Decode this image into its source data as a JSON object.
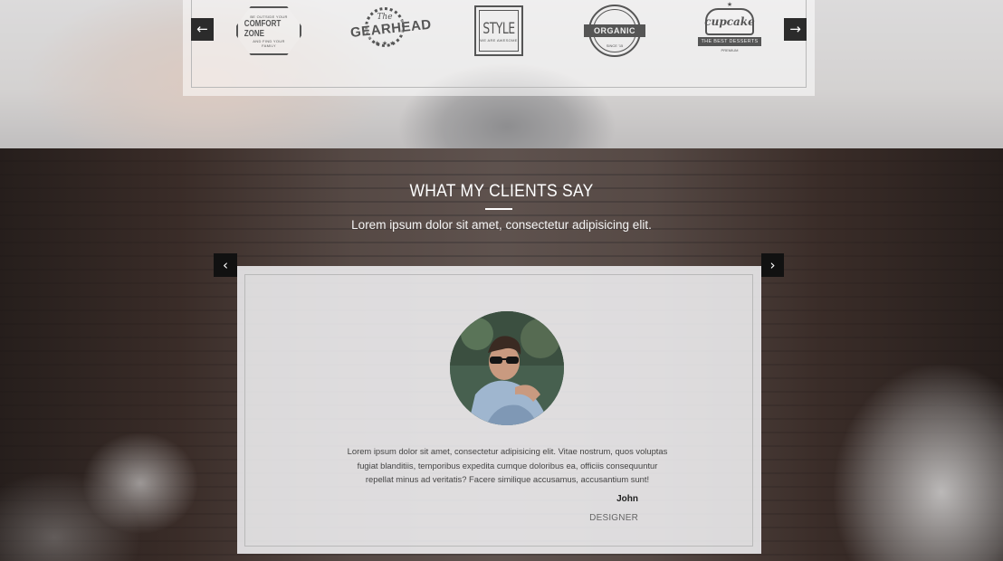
{
  "clients": {
    "prev_icon": "arrow-left-icon",
    "next_icon": "arrow-right-icon",
    "prev_glyph": "←",
    "next_glyph": "→",
    "logos": [
      {
        "name": "COMFORT ZONE",
        "top": "BE OUTSIDE YOUR",
        "sub": "AND FIND YOUR",
        "tag": "FAMILY"
      },
      {
        "name": "GEARHEAD",
        "script": "The"
      },
      {
        "name": "STYLE",
        "sub": "WE ARE AWESOME"
      },
      {
        "name": "ORGANIC",
        "sub": "SINCE '15"
      },
      {
        "name": "cupcake",
        "band": "THE BEST DESSERTS",
        "sub": "PREMIUM"
      }
    ]
  },
  "testimonials": {
    "title": "WHAT MY CLIENTS SAY",
    "subtitle": "Lorem ipsum dolor sit amet, consectetur adipisicing elit.",
    "prev_glyph": "‹",
    "next_glyph": "›",
    "quote": "Lorem ipsum dolor sit amet, consectetur adipisicing elit. Vitae nostrum, quos voluptas fugiat blanditiis, temporibus expedita cumque doloribus ea, officiis consequuntur repellat minus ad veritatis? Facere similique accusamus, accusantium sunt!",
    "author": "John",
    "role": "DESIGNER"
  },
  "colors": {
    "dark_button": "#111111",
    "text_white": "#ffffff"
  }
}
